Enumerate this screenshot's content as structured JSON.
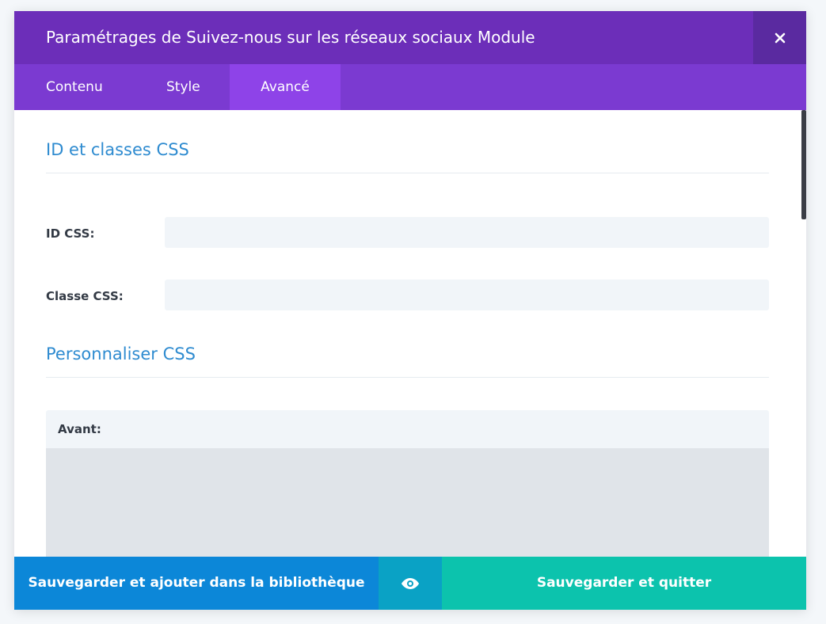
{
  "header": {
    "title": "Paramétrages de Suivez-nous sur les réseaux sociaux Module",
    "close_icon": "close-icon"
  },
  "tabs": [
    {
      "label": "Contenu",
      "active": false
    },
    {
      "label": "Style",
      "active": false
    },
    {
      "label": "Avancé",
      "active": true
    }
  ],
  "sections": {
    "id_classes": {
      "title": "ID et classes CSS",
      "fields": {
        "css_id": {
          "label": "ID CSS:",
          "value": "",
          "placeholder": ""
        },
        "css_class": {
          "label": "Classe CSS:",
          "value": "",
          "placeholder": ""
        }
      }
    },
    "custom_css": {
      "title": "Personnaliser CSS",
      "before": {
        "label": "Avant:",
        "value": ""
      }
    }
  },
  "footer": {
    "save_library_label": "Sauvegarder et ajouter dans la bibliothèque",
    "preview_icon": "eye-icon",
    "save_quit_label": "Sauvegarder et quitter"
  },
  "colors": {
    "header": "#6c2eb9",
    "tabs": "#7b3ad1",
    "tab_active": "#8e43e8",
    "section_title": "#2e8bd0",
    "btn_library": "#0c87d8",
    "btn_preview": "#0aa2c5",
    "btn_save": "#0cc3ad"
  }
}
